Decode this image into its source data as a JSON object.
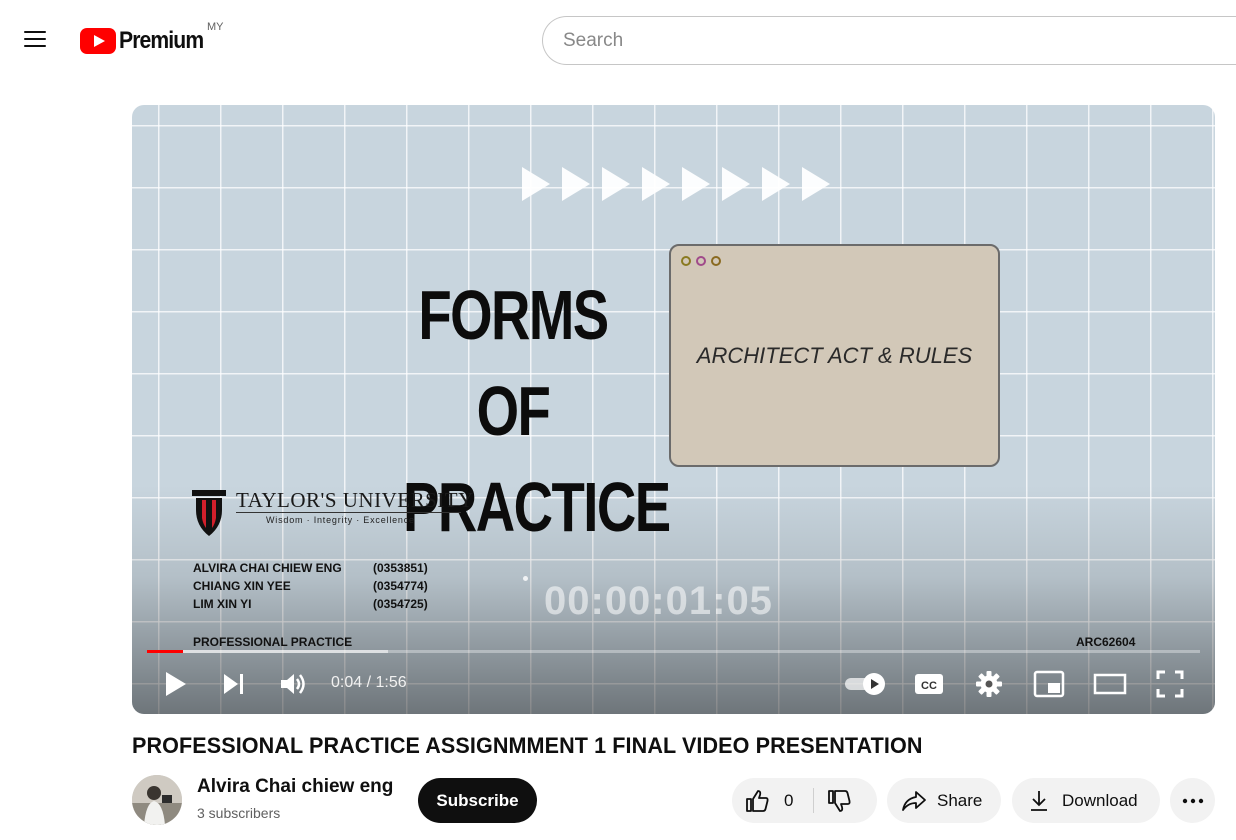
{
  "header": {
    "logo_text": "Premium",
    "region": "MY",
    "search_placeholder": "Search"
  },
  "video_frame": {
    "slide_title_line1": "FORMS OF",
    "slide_title_line2": "PRACTICE",
    "window_label": "ARCHITECT ACT & RULES",
    "university_name": "TAYLOR'S UNIVERSITY",
    "university_motto": "Wisdom · Integrity · Excellence",
    "members": [
      {
        "name": "ALVIRA CHAI CHIEW ENG",
        "id": "(0353851)"
      },
      {
        "name": "CHIANG XIN YEE",
        "id": "(0354774)"
      },
      {
        "name": "LIM XIN YI",
        "id": "(0354725)"
      }
    ],
    "course": "PROFESSIONAL PRACTICE",
    "course_code": "ARC62604",
    "overlay_timecode": "00:00:01:05"
  },
  "player": {
    "time_display": "0:04 / 1:56",
    "played_fraction": 0.034,
    "buffered_fraction": 0.229
  },
  "video": {
    "title": "PROFESSIONAL PRACTICE ASSIGNMMENT 1 FINAL VIDEO PRESENTATION",
    "channel_name": "Alvira Chai chiew eng",
    "subscribers": "3 subscribers",
    "subscribe_label": "Subscribe",
    "like_count": "0",
    "share_label": "Share",
    "download_label": "Download"
  },
  "colors": {
    "brand_red": "#ff0000",
    "text_primary": "#0f0f0f",
    "text_secondary": "#606060"
  }
}
